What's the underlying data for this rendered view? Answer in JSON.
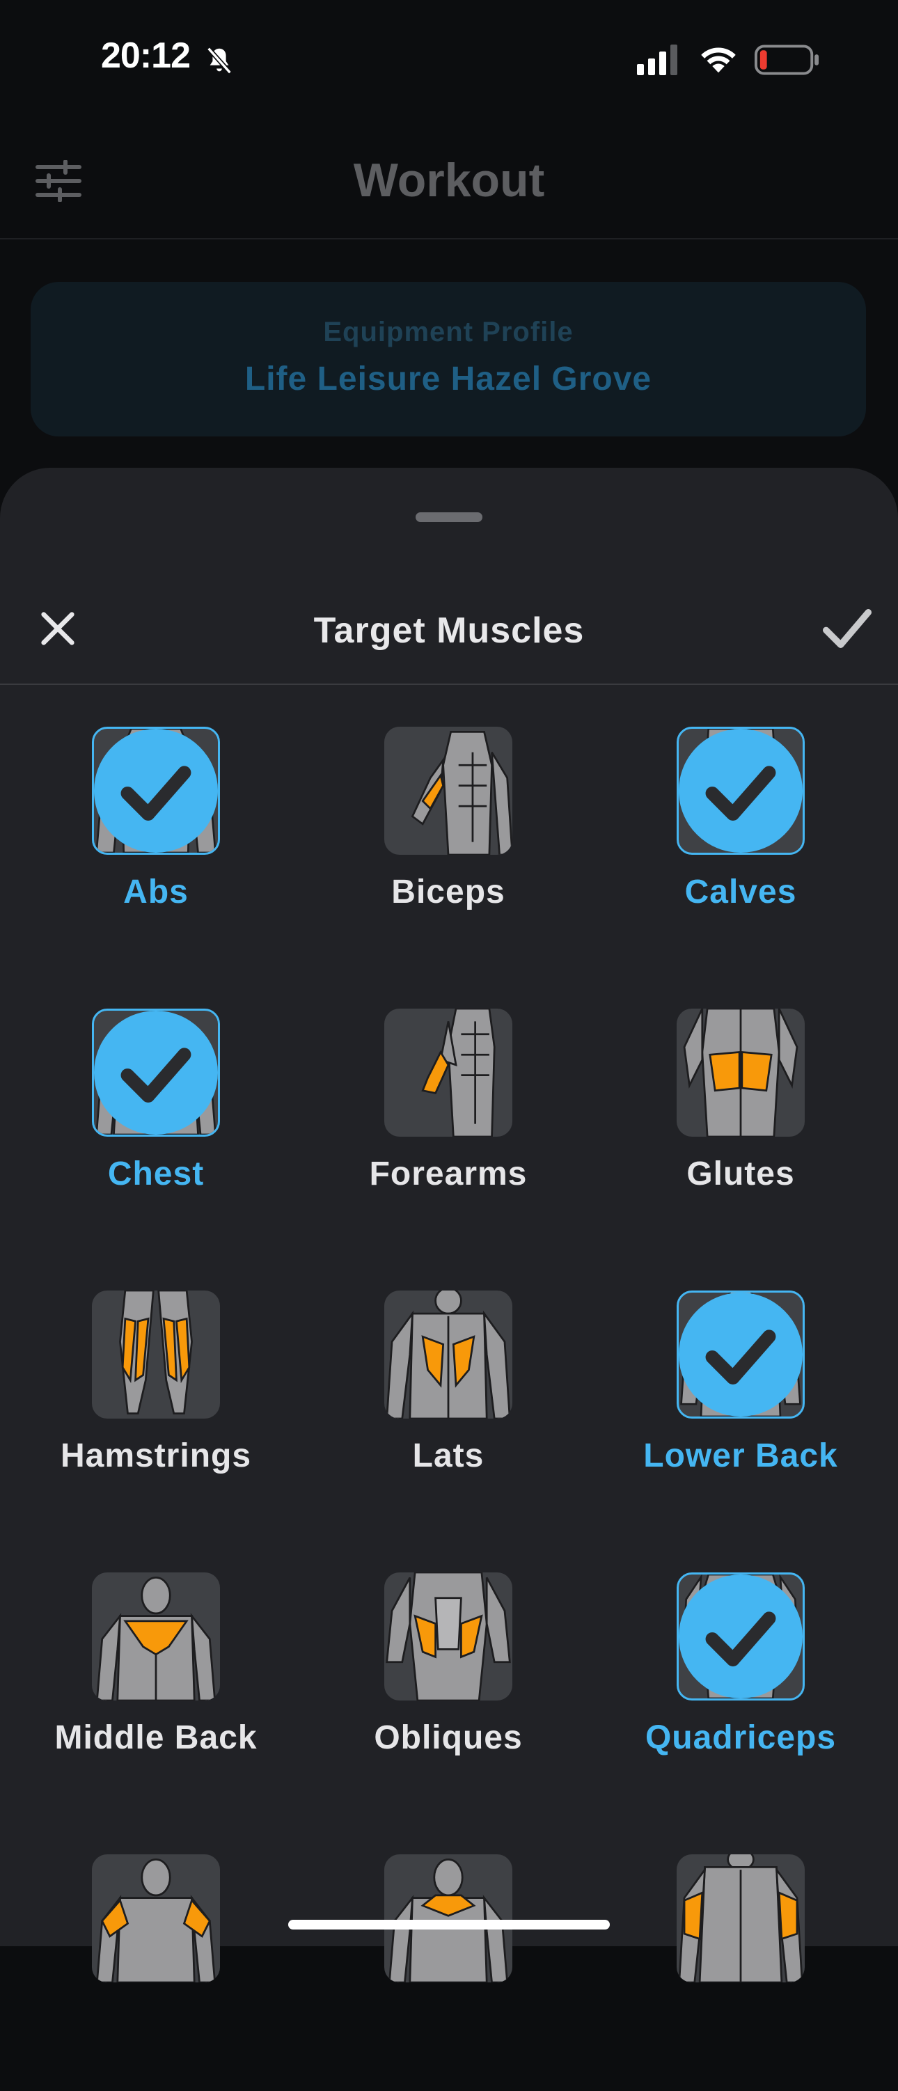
{
  "status_bar": {
    "time": "20:12"
  },
  "header": {
    "title": "Workout"
  },
  "equipment": {
    "label": "Equipment Profile",
    "name": "Life Leisure Hazel Grove"
  },
  "sheet": {
    "title": "Target Muscles"
  },
  "muscles": [
    {
      "label": "Abs",
      "selected": true
    },
    {
      "label": "Biceps",
      "selected": false
    },
    {
      "label": "Calves",
      "selected": true
    },
    {
      "label": "Chest",
      "selected": true
    },
    {
      "label": "Forearms",
      "selected": false
    },
    {
      "label": "Glutes",
      "selected": false
    },
    {
      "label": "Hamstrings",
      "selected": false
    },
    {
      "label": "Lats",
      "selected": false
    },
    {
      "label": "Lower Back",
      "selected": true
    },
    {
      "label": "Middle Back",
      "selected": false
    },
    {
      "label": "Obliques",
      "selected": false
    },
    {
      "label": "Quadriceps",
      "selected": true
    }
  ],
  "colors": {
    "accent": "#45b6f2",
    "highlight": "#f8990a",
    "sheet_bg": "#212226",
    "tile_bg": "#3f4145"
  }
}
